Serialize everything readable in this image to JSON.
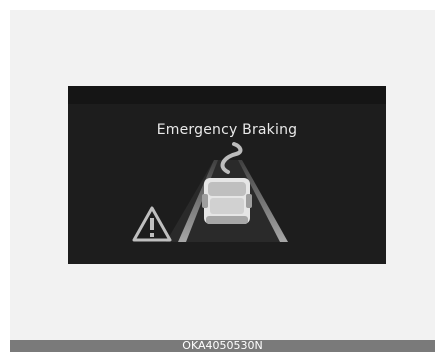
{
  "display": {
    "title": "Emergency Braking"
  },
  "caption": {
    "code": "OKA4050530N"
  },
  "icons": {
    "warning": "warning-triangle-icon",
    "vehicle": "vehicle-icon"
  },
  "colors": {
    "screen_background": "#1d1d1d",
    "text": "#e9e9e9",
    "caption_background": "#7a7a7a"
  }
}
